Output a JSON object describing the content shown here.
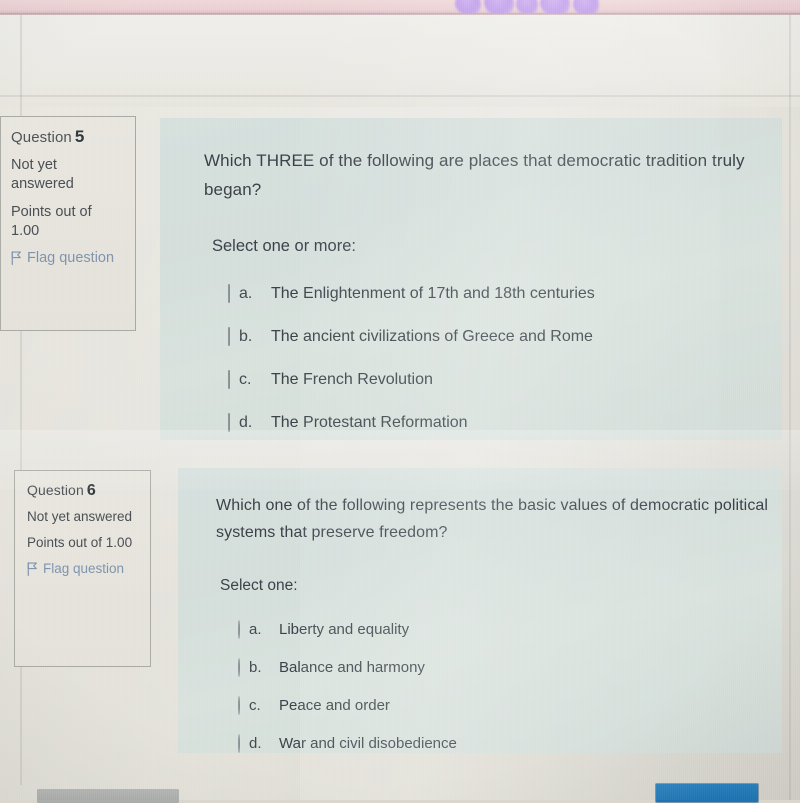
{
  "page": {
    "background_color": "#e4e2db",
    "panel_tint_color": "#d6e0dd",
    "link_color": "#7e93ad",
    "text_color": "#3b4147",
    "accent_button_color": "#1f73b4"
  },
  "questions": [
    {
      "info": {
        "label": "Question",
        "number": "5",
        "state": "Not yet answered",
        "points": "Points out of 1.00",
        "flag_label": "Flag question",
        "flag_icon": "flag-icon"
      },
      "text": "Which THREE of the following are places that democratic tradition truly began?",
      "prompt": "Select one or more:",
      "input_type": "checkbox",
      "options": [
        {
          "letter": "a.",
          "text": "The Enlightenment of 17th  and 18th centuries",
          "checked": false
        },
        {
          "letter": "b.",
          "text": "The ancient civilizations of Greece and Rome",
          "checked": false
        },
        {
          "letter": "c.",
          "text": "The French Revolution",
          "checked": false
        },
        {
          "letter": "d.",
          "text": "The Protestant Reformation",
          "checked": false
        }
      ]
    },
    {
      "info": {
        "label": "Question",
        "number": "6",
        "state": "Not yet answered",
        "points": "Points out of 1.00",
        "flag_label": "Flag question",
        "flag_icon": "flag-icon"
      },
      "text": "Which one of the following represents the basic values of democratic political systems that preserve freedom?",
      "prompt": "Select one:",
      "input_type": "radio",
      "options": [
        {
          "letter": "a.",
          "text": "Liberty and equality",
          "checked": false
        },
        {
          "letter": "b.",
          "text": "Balance and harmony",
          "checked": false
        },
        {
          "letter": "c.",
          "text": "Peace and order",
          "checked": false
        },
        {
          "letter": "d.",
          "text": "War and civil disobedience",
          "checked": false
        }
      ]
    }
  ],
  "bottom_bar": {
    "blue_button_label": "",
    "gray_bar_label": ""
  }
}
